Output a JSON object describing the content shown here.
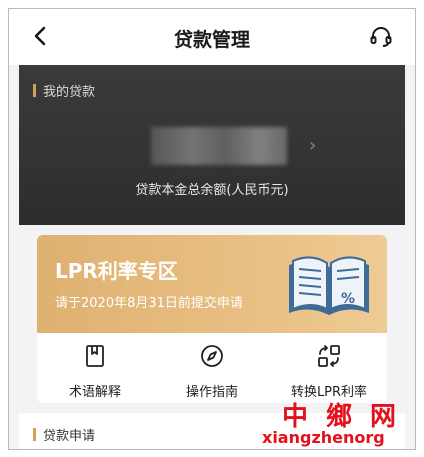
{
  "header": {
    "title": "贷款管理"
  },
  "loan_card": {
    "section_label": "我的贷款",
    "amount_caption": "贷款本金总余额(人民币元)"
  },
  "promo": {
    "title": "LPR利率专区",
    "subtitle": "请于2020年8月31日前提交申请"
  },
  "actions": [
    {
      "label": "术语解释",
      "icon": "bookmark-icon"
    },
    {
      "label": "操作指南",
      "icon": "compass-icon"
    },
    {
      "label": "转换LPR利率",
      "icon": "convert-icon"
    }
  ],
  "apply": {
    "section_label": "贷款申请"
  },
  "watermark": {
    "cn": "中鄉网",
    "en": "xiangzhenorg"
  },
  "colors": {
    "gold": "#d1a25a",
    "card_dark": "#333333",
    "promo": "#e8bf83",
    "watermark": "#e4111b"
  }
}
